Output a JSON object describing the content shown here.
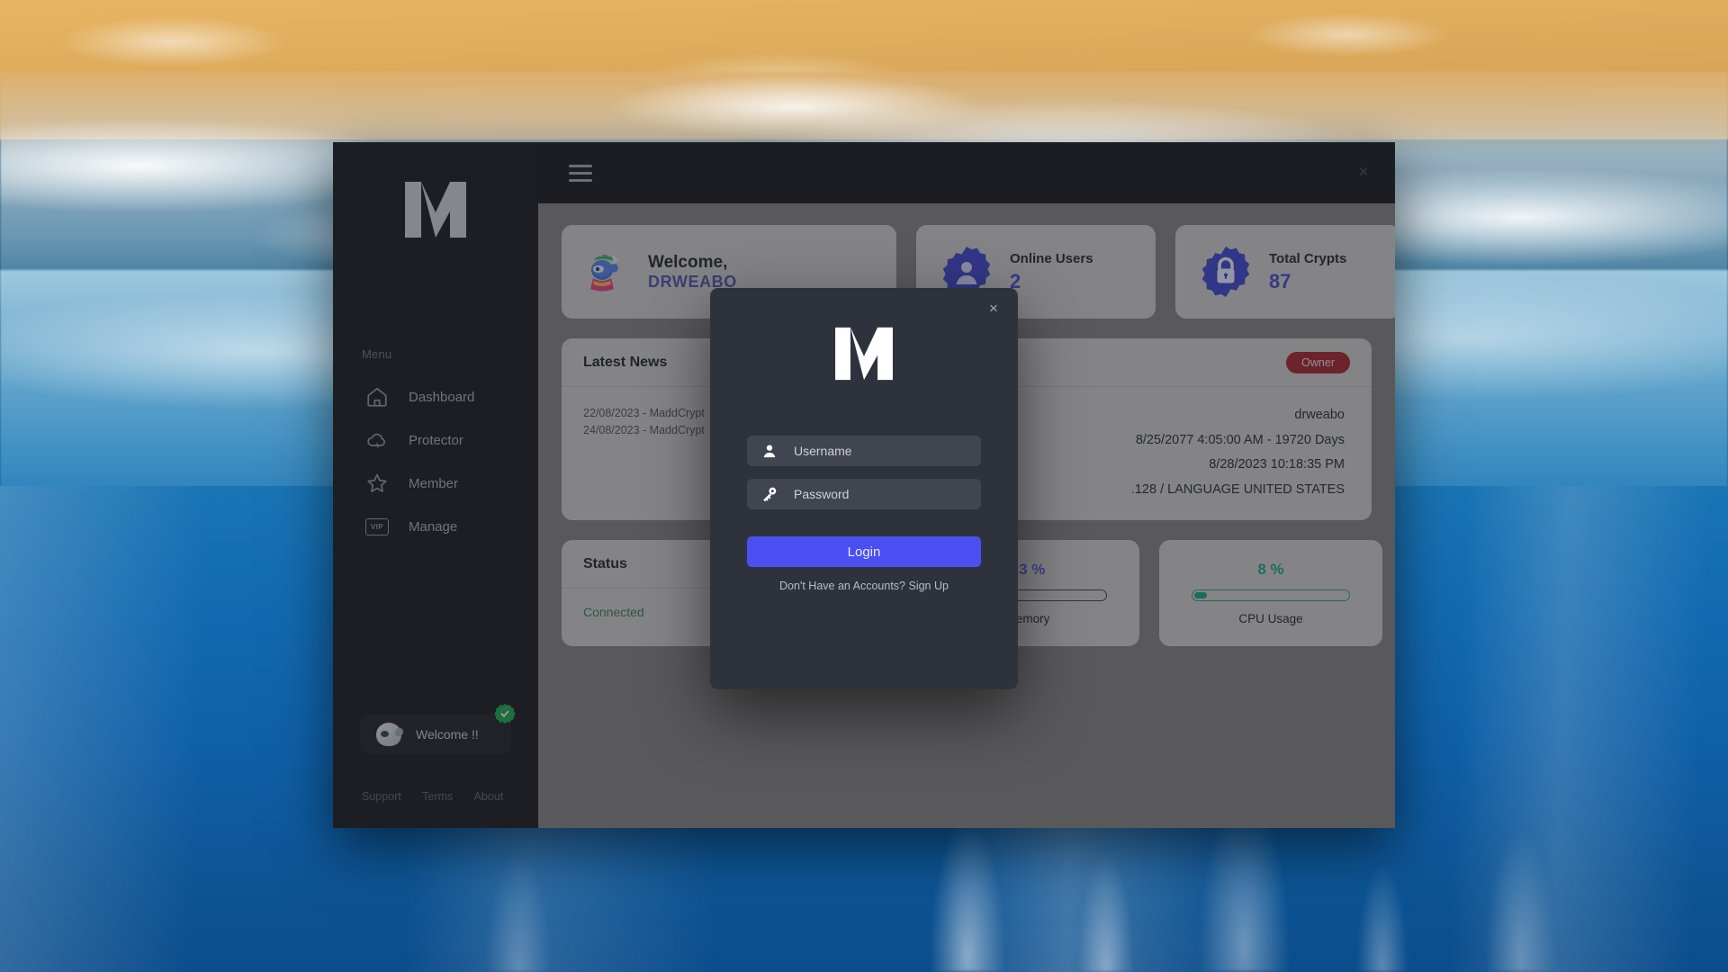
{
  "window": {
    "close_label": "×"
  },
  "topbar": {
    "menu_icon": "hamburger-icon",
    "close_icon": "close-icon"
  },
  "sidebar": {
    "logo_name": "maddcrypt-logo",
    "menu_heading": "Menu",
    "items": [
      {
        "label": "Dashboard",
        "icon": "home-icon"
      },
      {
        "label": "Protector",
        "icon": "cloud-bolt-icon"
      },
      {
        "label": "Member",
        "icon": "star-icon"
      },
      {
        "label": "Manage",
        "icon": "vip-badge-icon",
        "badge_text": "VIP"
      }
    ],
    "user_pill": {
      "label": "Welcome !!",
      "avatar_icon": "user-avatar",
      "verified_icon": "verified-check-icon"
    },
    "footer": {
      "links": [
        "Support",
        "Terms",
        "About"
      ],
      "separator": "·"
    }
  },
  "main": {
    "welcome_card": {
      "icon": "mascot-icon",
      "greeting": "Welcome,",
      "username": "DRWEABO"
    },
    "online_users_card": {
      "icon": "gear-user-icon",
      "title": "Online Users",
      "value": "2"
    },
    "total_crypts_card": {
      "icon": "lock-badge-icon",
      "title": "Total Crypts",
      "value": "87"
    },
    "news_card": {
      "title": "Latest News",
      "entries": [
        "22/08/2023 - MaddCrypt",
        "24/08/2023 - MaddCrypt"
      ]
    },
    "user_card": {
      "role_badge": "Owner",
      "username": "drweabo",
      "expiry": "8/25/2077 4:05:00 AM - 19720 Days",
      "last_login": "8/28/2023 10:18:35 PM",
      "locale": ".128 / LANGUAGE UNITED STATES"
    },
    "status_card": {
      "title": "Status",
      "value": "Connected",
      "value_color": "#2c7a53"
    },
    "memory_card": {
      "percent_text": "23 %",
      "percent": 23,
      "label": "Memory",
      "color": "#5b3fd9"
    },
    "cpu_card": {
      "percent_text": "8 %",
      "percent": 8,
      "label": "CPU Usage",
      "color": "#179e86"
    }
  },
  "login_modal": {
    "logo_name": "maddcrypt-logo",
    "close_label": "×",
    "username": {
      "value": "",
      "placeholder": "Username",
      "icon": "person-icon"
    },
    "password": {
      "value": "",
      "placeholder": "Password",
      "icon": "key-icon"
    },
    "login_label": "Login",
    "signup_text": "Don't Have an Accounts? Sign Up",
    "accent_color": "#4b4ef0"
  }
}
